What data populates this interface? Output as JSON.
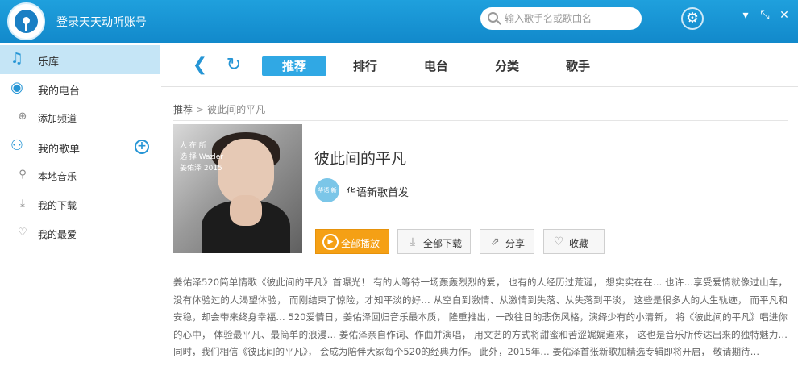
{
  "header": {
    "login_text": "登录天天动听账号",
    "search_placeholder": "输入歌手名或歌曲名",
    "settings_icon": "gear-icon",
    "minimize_icon": "minimize-icon",
    "mini_mode_icon": "collapse-icon",
    "close_icon": "close-icon"
  },
  "sidebar": {
    "items": [
      {
        "label": "乐库",
        "icon": "music-note-icon"
      },
      {
        "label": "我的电台",
        "icon": "radio-icon"
      },
      {
        "label": "添加频道",
        "icon": "add-channel-icon"
      },
      {
        "label": "我的歌单",
        "icon": "user-playlist-icon"
      },
      {
        "label": "本地音乐",
        "icon": "location-pin-icon"
      },
      {
        "label": "我的下载",
        "icon": "download-icon"
      },
      {
        "label": "我的最爱",
        "icon": "heart-icon"
      }
    ]
  },
  "nav": {
    "tabs": [
      "推荐",
      "排行",
      "电台",
      "分类",
      "歌手"
    ],
    "active_tab": "推荐"
  },
  "breadcrumb": {
    "root": "推荐",
    "separator": ">",
    "current": "彼此间的平凡"
  },
  "album": {
    "title": "彼此间的平凡",
    "artist_avatar_text": "华语 新歌",
    "artist": "华语新歌首发",
    "cover_text_1": "人 在  所",
    "cover_text_2": "选 择 Wazler",
    "cover_text_3": "姜佑泽 2015",
    "buttons": {
      "play_all": "全部播放",
      "download_all": "全部下载",
      "share": "分享",
      "favorite": "收藏"
    },
    "description": "姜佑泽520简单情歌《彼此间的平凡》首曝光！ 有的人等待一场轰轰烈烈的爱， 也有的人经历过荒诞， 想实实在在… 也许…享受爱情就像过山车， 没有体验过的人渴望体验， 而刚结束了惊险，才知平淡的好… 从空白到激情、从激情到失落、从失落到平淡， 这些是很多人的人生轨迹， 而平凡和安稳，却会带来终身幸福… 520爱情日，姜佑泽回归音乐最本质， 隆重推出，一改往日的悲伤风格，演绎少有的小清新， 将《彼此间的平凡》唱进你的心中， 体验最平凡、最简单的浪漫… 姜佑泽亲自作词、作曲并演唱， 用文艺的方式将甜蜜和苦涩娓娓道来， 这也是音乐所传达出来的独特魅力… 同时，我们相信《彼此间的平凡》， 会成为陪伴大家每个520的经典力作。 此外，2015年… 姜佑泽首张新歌加精选专辑即将开启， 敬请期待…"
  },
  "colors": {
    "titlebar": "#1a95d6",
    "accent": "#30a8e4",
    "play_button": "#f5a015",
    "sidebar_active": "#c5e5f6"
  }
}
